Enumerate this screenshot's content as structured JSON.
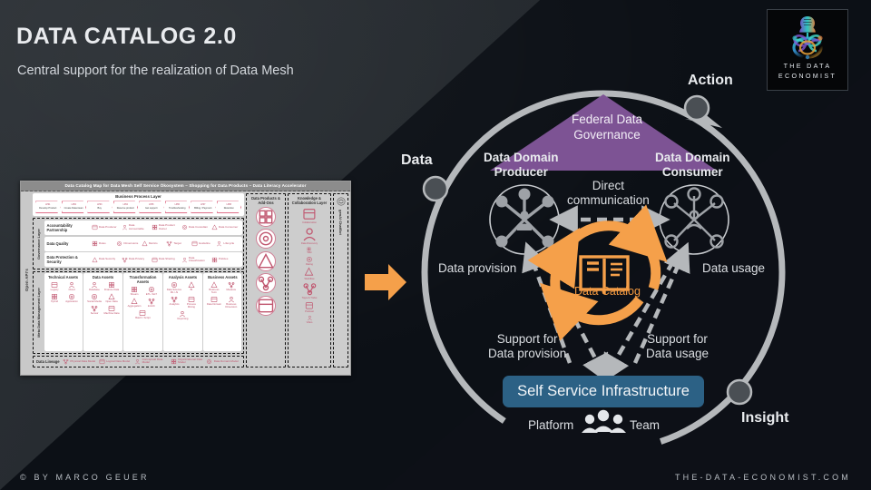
{
  "header": {
    "title": "DATA CATALOG 2.0",
    "subtitle": "Central support for the realization of Data Mesh"
  },
  "logo": {
    "line1": "THE DATA",
    "line2": "ECONOMIST"
  },
  "footer": {
    "left": "© BY MARCO GEUER",
    "right": "THE-DATA-ECONOMIST.COM"
  },
  "colors": {
    "orange": "#f5a04a",
    "purple": "#7d5394",
    "blue": "#2c6185",
    "ring_gray": "#b5b8bb",
    "map_pink": "#c0566f",
    "background_dark": "#0d1117",
    "background_light": "#2b3035"
  },
  "diagram": {
    "cycle_nodes": [
      {
        "label": "Data"
      },
      {
        "label": "Action"
      },
      {
        "label": "Insight"
      }
    ],
    "governance": {
      "line1": "Federal Data",
      "line2": "Governance"
    },
    "producer": {
      "line1": "Data Domain",
      "line2": "Producer"
    },
    "consumer": {
      "line1": "Data Domain",
      "line2": "Consumer"
    },
    "direct_communication": {
      "line1": "Direct",
      "line2": "communication"
    },
    "data_provision": "Data provision",
    "data_usage": "Data usage",
    "support_provision": {
      "line1": "Support  for",
      "line2": "Data provision"
    },
    "support_usage": {
      "line1": "Support  for",
      "line2": "Data usage"
    },
    "catalog_label": "Data  Catalog",
    "self_service": "Self Service Infrastructure",
    "platform": "Platform",
    "team": "Team"
  },
  "map": {
    "title": "Data Catalog Map for Data Mesh Self Service Ökosystem – Shopping for Data Products – Data Literacy Accelerator",
    "open_apis": "Open API's",
    "business_process_layer": "Business Process Layer",
    "process_steps": [
      {
        "top": "LP01",
        "label": "Develop Product"
      },
      {
        "top": "LP02",
        "label": "Create Datenteam"
      },
      {
        "top": "LP03",
        "label": "Buy"
      },
      {
        "top": "LP04",
        "label": "Reserve product"
      },
      {
        "top": "LP05",
        "label": "Get support"
      },
      {
        "top": "LP06",
        "label": "Troubleshooting"
      },
      {
        "top": "LP07",
        "label": "Billing / Payment"
      },
      {
        "top": "LP08",
        "label": "Retention"
      }
    ],
    "governance_layer": "Governance Layer",
    "governance_rows": [
      {
        "label": "Accountability Partnership",
        "items": [
          "Data Producer",
          "Data Accountable",
          "Data Product Owner",
          "Data Custodian",
          "Data Consumer"
        ]
      },
      {
        "label": "Data Quality",
        "items": [
          "Rules",
          "Dimensions",
          "Metrics",
          "Target",
          "Guideline",
          "Lifecycle"
        ]
      },
      {
        "label": "Data Protection & Security",
        "items": [
          "Data Security",
          "Data Privacy",
          "Data Sharing",
          "Data Classification",
          "Policies"
        ]
      }
    ],
    "meta_layer": "Meta Data Management Layer",
    "asset_cards": [
      {
        "title": "Technical Assets",
        "items": [
          "Legacy",
          "Cloud",
          "Hybrid",
          "Application"
        ]
      },
      {
        "title": "Data Assets",
        "items": [
          "Database",
          "Finance Data",
          "Social Media",
          "Open Data",
          "Sensor",
          "Machine Data"
        ]
      },
      {
        "title": "Transformation Assets",
        "items": [
          "Stream",
          "ETL / ELT",
          "Aggregation",
          "Enrich",
          "Batch / Script"
        ]
      },
      {
        "title": "Analysis Assets",
        "items": [
          "Data Science ML / AI",
          "BI",
          "Analytics",
          "Process Mining",
          "Reporting"
        ]
      },
      {
        "title": "Business Assets",
        "items": [
          "Business Term",
          "Measure",
          "Data Domain",
          "Business Dimension"
        ]
      }
    ],
    "lineage_label": "Data Lineage",
    "lineage_items": [
      "Physical Data Model",
      "Logical Data Model",
      "Conceptual Data Model",
      "Organizational Data Model",
      "Data Domain Model"
    ],
    "products_col": {
      "title": "Data Products & Add-Ons",
      "count": 5
    },
    "knowledge_col": {
      "title": "Knowledge & Collaboration Layer",
      "items": [
        "Collaboration",
        "Data Discovery",
        "Wiki",
        "Rating",
        "Workflow",
        "Tipps & Tricks",
        "Podcast",
        "Video"
      ]
    },
    "chatbot": "genAI ChatBot"
  }
}
